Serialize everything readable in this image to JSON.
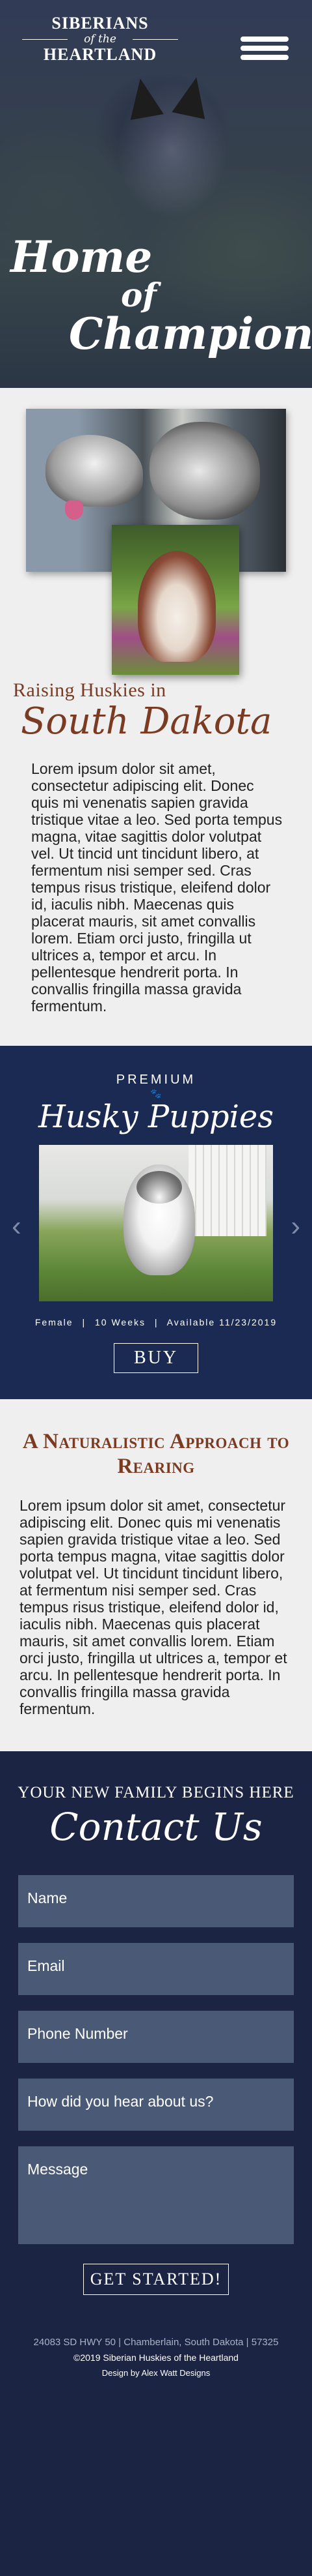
{
  "brand": {
    "line1": "Siberians",
    "line2": "of the",
    "line3": "Heartland"
  },
  "hero": {
    "title_line1": "Home",
    "title_line2": "of",
    "title_line3": "Champions"
  },
  "raising": {
    "subheading": "Raising Huskies in",
    "heading": "South Dakota",
    "body": "Lorem ipsum dolor sit amet, consectetur adipiscing elit. Donec quis mi venenatis sapien gravida tristique vitae a leo. Sed porta tempus magna, vitae sagittis dolor volutpat vel. Ut tincid unt tincidunt libero, at fermentum nisi semper sed. Cras tempus risus tristique, eleifend dolor id, iaculis nibh. Maecenas quis placerat mauris, sit amet convallis lorem. Etiam orci justo, fringilla ut ultrices a, tempor et arcu. In pellentesque hendrerit porta. In convallis fringilla massa gravida fermentum."
  },
  "puppies": {
    "pre": "PREMIUM",
    "title": "Husky Puppies",
    "gender": "Female",
    "age": "10 Weeks",
    "available": "Available 11/23/2019",
    "separator": "|",
    "buy_label": "BUY",
    "prev_icon": "chevron-left-icon",
    "next_icon": "chevron-right-icon"
  },
  "approach": {
    "heading": "A Naturalistic Approach to Rearing",
    "body": "Lorem ipsum dolor sit amet, consectetur adipiscing elit. Donec quis mi venenatis sapien gravida tristique vitae a leo. Sed porta tempus magna, vitae sagittis dolor volutpat vel. Ut tincidunt tincidunt libero, at fermentum nisi semper sed. Cras tempus risus tristique, eleifend dolor id, iaculis nibh. Maecenas quis placerat mauris, sit amet convallis lorem. Etiam orci justo, fringilla ut ultrices a, tempor et arcu. In pellentesque hendrerit porta. In convallis fringilla massa gravida fermentum."
  },
  "contact": {
    "pre": "YOUR NEW FAMILY BEGINS HERE",
    "title": "Contact Us",
    "fields": {
      "name": "Name",
      "email": "Email",
      "phone": "Phone Number",
      "hear": "How did you hear about us?",
      "message": "Message"
    },
    "submit_label": "GET STARTED!"
  },
  "footer": {
    "address": "24083 SD HWY 50 | Chamberlain, South Dakota | 57325",
    "copyright": "©2019 Siberian Huskies of the Heartland",
    "credit": "Design by Alex Watt Designs"
  },
  "colors": {
    "navy": "#1b2443",
    "accent_brown": "#7a3b22",
    "field_bg": "#4a5a76",
    "light_bg": "#efefef"
  }
}
